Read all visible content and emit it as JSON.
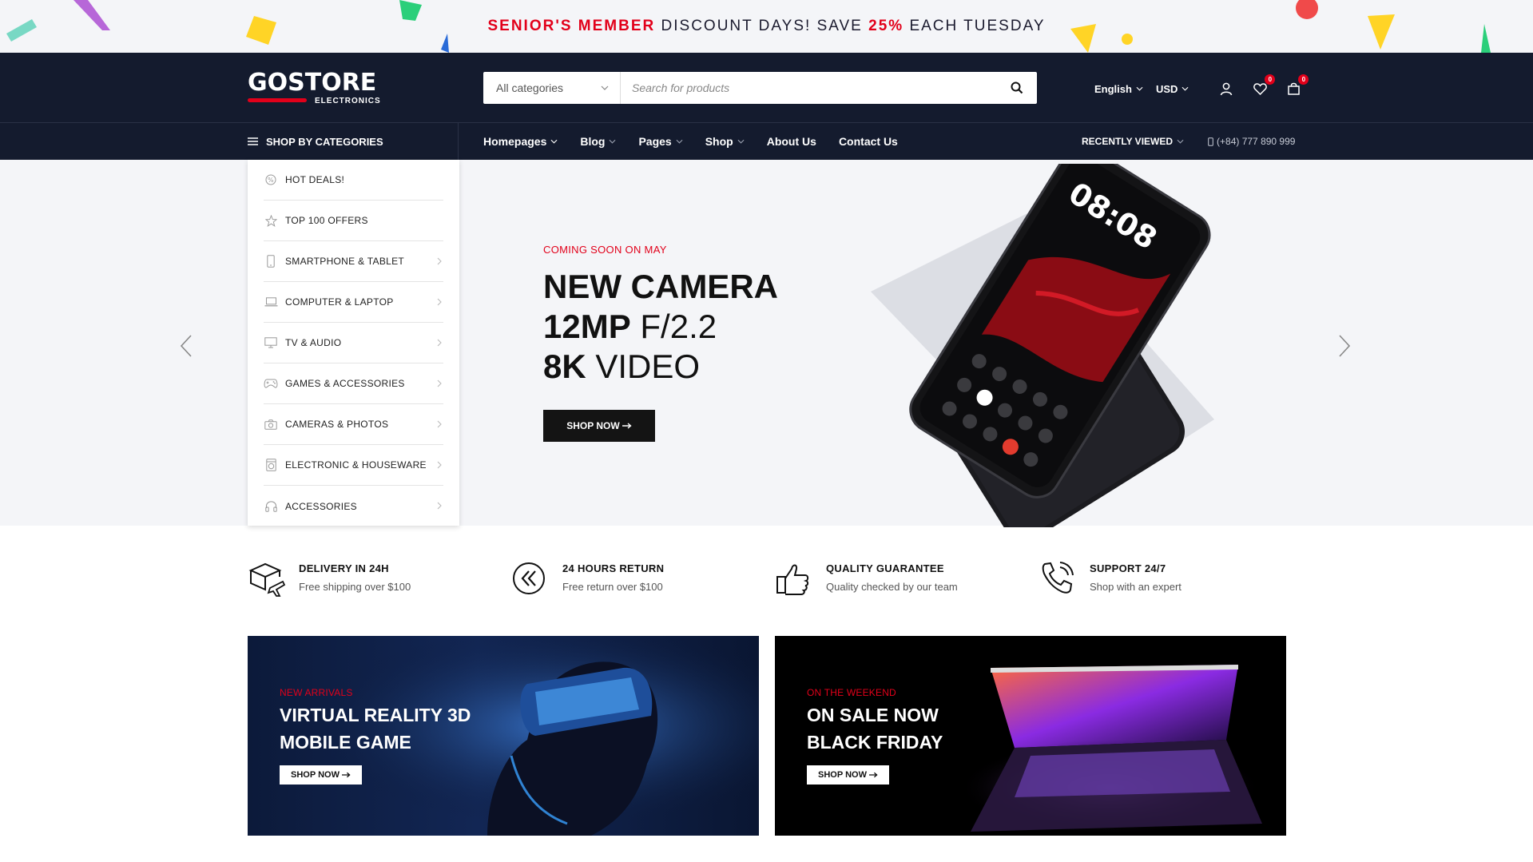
{
  "promo": {
    "part1": "SENIOR'S MEMBER",
    "part2": " DISCOUNT DAYS! SAVE ",
    "part3": "25%",
    "part4": " EACH TUESDAY"
  },
  "header": {
    "logo": "GOSTORE",
    "logo_sub": "ELECTRONICS",
    "search_category": "All categories",
    "search_placeholder": "Search for products",
    "language": "English",
    "currency": "USD",
    "wishlist_count": "0",
    "cart_count": "0"
  },
  "nav": {
    "categories_label": "SHOP BY CATEGORIES",
    "links": [
      "Homepages",
      "Blog",
      "Pages",
      "Shop",
      "About Us",
      "Contact Us"
    ],
    "recently_viewed": "RECENTLY VIEWED",
    "phone": "(+84) 777 890 999"
  },
  "side_menu": {
    "items": [
      {
        "label": "HOT DEALS!",
        "icon": "hot-deals-icon"
      },
      {
        "label": "TOP 100 OFFERS",
        "icon": "star-icon"
      },
      {
        "label": "SMARTPHONE & TABLET",
        "icon": "smartphone-icon"
      },
      {
        "label": "COMPUTER & LAPTOP",
        "icon": "laptop-icon"
      },
      {
        "label": "TV & AUDIO",
        "icon": "tv-icon"
      },
      {
        "label": "GAMES & ACCESSORIES",
        "icon": "gamepad-icon"
      },
      {
        "label": "CAMERAS & PHOTOS",
        "icon": "camera-icon"
      },
      {
        "label": "ELECTRONIC & HOUSEWARE",
        "icon": "washer-icon"
      },
      {
        "label": "ACCESSORIES",
        "icon": "headphones-icon"
      }
    ]
  },
  "hero": {
    "tag": "COMING SOON ON MAY",
    "line1_bold": "NEW CAMERA",
    "line2_bold": "12MP",
    "line2_light": " F/2.2",
    "line3_bold": "8K",
    "line3_light": " VIDEO",
    "button": "SHOP NOW",
    "phone_time": "08:08"
  },
  "features": [
    {
      "title": "DELIVERY IN 24H",
      "sub": "Free shipping over $100",
      "icon": "delivery-icon"
    },
    {
      "title": "24 HOURS RETURN",
      "sub": "Free return over $100",
      "icon": "return-icon"
    },
    {
      "title": "QUALITY GUARANTEE",
      "sub": "Quality checked by our team",
      "icon": "thumbs-up-icon"
    },
    {
      "title": "SUPPORT 24/7",
      "sub": "Shop with an expert",
      "icon": "phone-support-icon"
    }
  ],
  "banners": [
    {
      "tag": "NEW ARRIVALS",
      "title1": "VIRTUAL REALITY 3D",
      "title2": "MOBILE GAME",
      "button": "SHOP NOW"
    },
    {
      "tag": "ON THE WEEKEND",
      "title1": "ON SALE NOW",
      "title2": "BLACK FRIDAY",
      "button": "SHOP NOW"
    }
  ],
  "colors": {
    "accent": "#e2001a",
    "navy": "#141b2e",
    "hero_bg": "#f4f5f8"
  }
}
